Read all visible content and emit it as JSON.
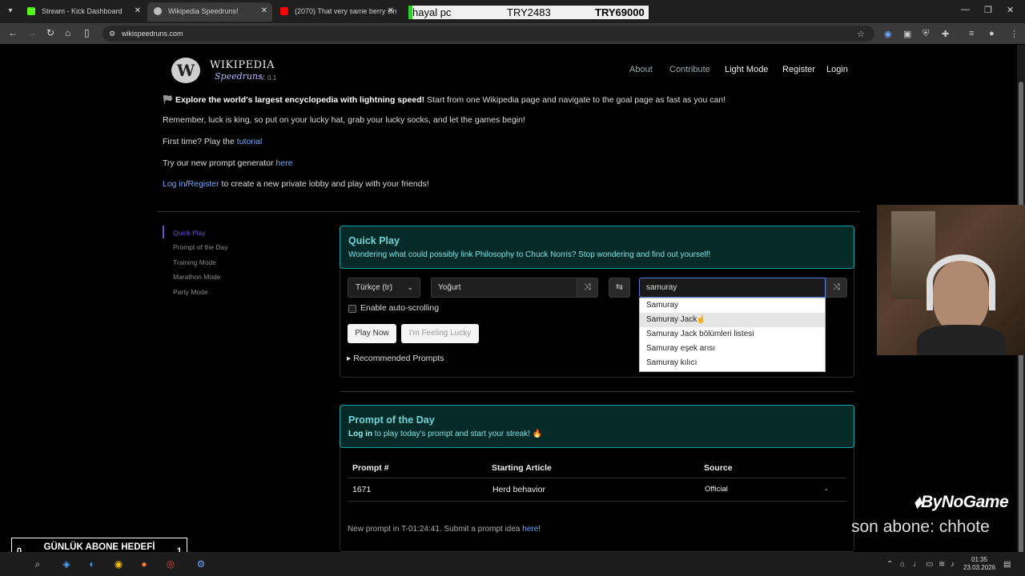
{
  "browser": {
    "tabs": [
      {
        "label": "Stream - Kick Dashboard",
        "color": "#53fc18"
      },
      {
        "label": "Wikipedia Speedruns!",
        "color": "#cccccc"
      },
      {
        "label": "(2070) That very same berry sin",
        "color": "#ff0000"
      }
    ],
    "url": "wikispeedruns.com"
  },
  "stream_overlay": {
    "top_left": "hayal pc",
    "top_mid": "TRY2483",
    "top_right": "TRY69000",
    "goal_title": "GÜNLÜK ABONE HEDEFİ",
    "goal_min": "0",
    "goal_max": "1",
    "sponsor": "ByNoGame",
    "last_sub": "son abone: chhote"
  },
  "site": {
    "logo_title": "WIKIPEDIA",
    "logo_sub": "Speedruns",
    "logo_version": "V. 0.1",
    "nav": [
      "About",
      "Contribute",
      "Light Mode",
      "Register",
      "Login"
    ],
    "intro": {
      "line1_bold": "Explore the world's largest encyclopedia with lightning speed!",
      "line1_rest": " Start from one Wikipedia page and navigate to the goal page as fast as you can!",
      "line2": "Remember, luck is king, so put on your lucky hat, grab your lucky socks, and let the games begin!",
      "line3_pre": "First time? Play the ",
      "line3_link": "tutorial",
      "line4_pre": "Try our new prompt generator ",
      "line4_link": "here",
      "line5_link1": "Log in",
      "line5_sep": "/",
      "line5_link2": "Register",
      "line5_rest": " to create a new private lobby and play with your friends!"
    },
    "sidebar": [
      "Quick Play",
      "Prompt of the Day",
      "Training Mode",
      "Marathon Mode",
      "Party Mode"
    ]
  },
  "quickplay": {
    "title": "Quick Play",
    "subtitle": "Wondering what could possibly link Philosophy to Chuck Norris? Stop wondering and find out yourself!",
    "language": "Türkçe (tr)",
    "start_value": "Yoğurt",
    "goal_value": "samuray",
    "suggestions": [
      "Samuray",
      "Samuray Jack",
      "Samuray Jack bölümleri listesi",
      "Samuray eşek arısı",
      "Samuray kılıcı"
    ],
    "autoscroll_label": "Enable auto-scrolling",
    "play_label": "Play Now",
    "lucky_label": "I'm Feeling Lucky",
    "recommended_label": "Recommended Prompts"
  },
  "potd": {
    "title": "Prompt of the Day",
    "login_link": "Log in",
    "subtitle_rest": " to play today's prompt and start your streak! 🔥",
    "columns": [
      "Prompt #",
      "Starting Article",
      "Source"
    ],
    "row": {
      "num": "1671",
      "start": "Herd behavior",
      "source": "Official",
      "extra": "-"
    },
    "footnote_pre": "New prompt in T-01:24:41. Submit a prompt idea ",
    "footnote_link": "here",
    "footnote_end": "!"
  },
  "taskbar": {
    "time": "01:35",
    "date": "23.03.2026"
  }
}
